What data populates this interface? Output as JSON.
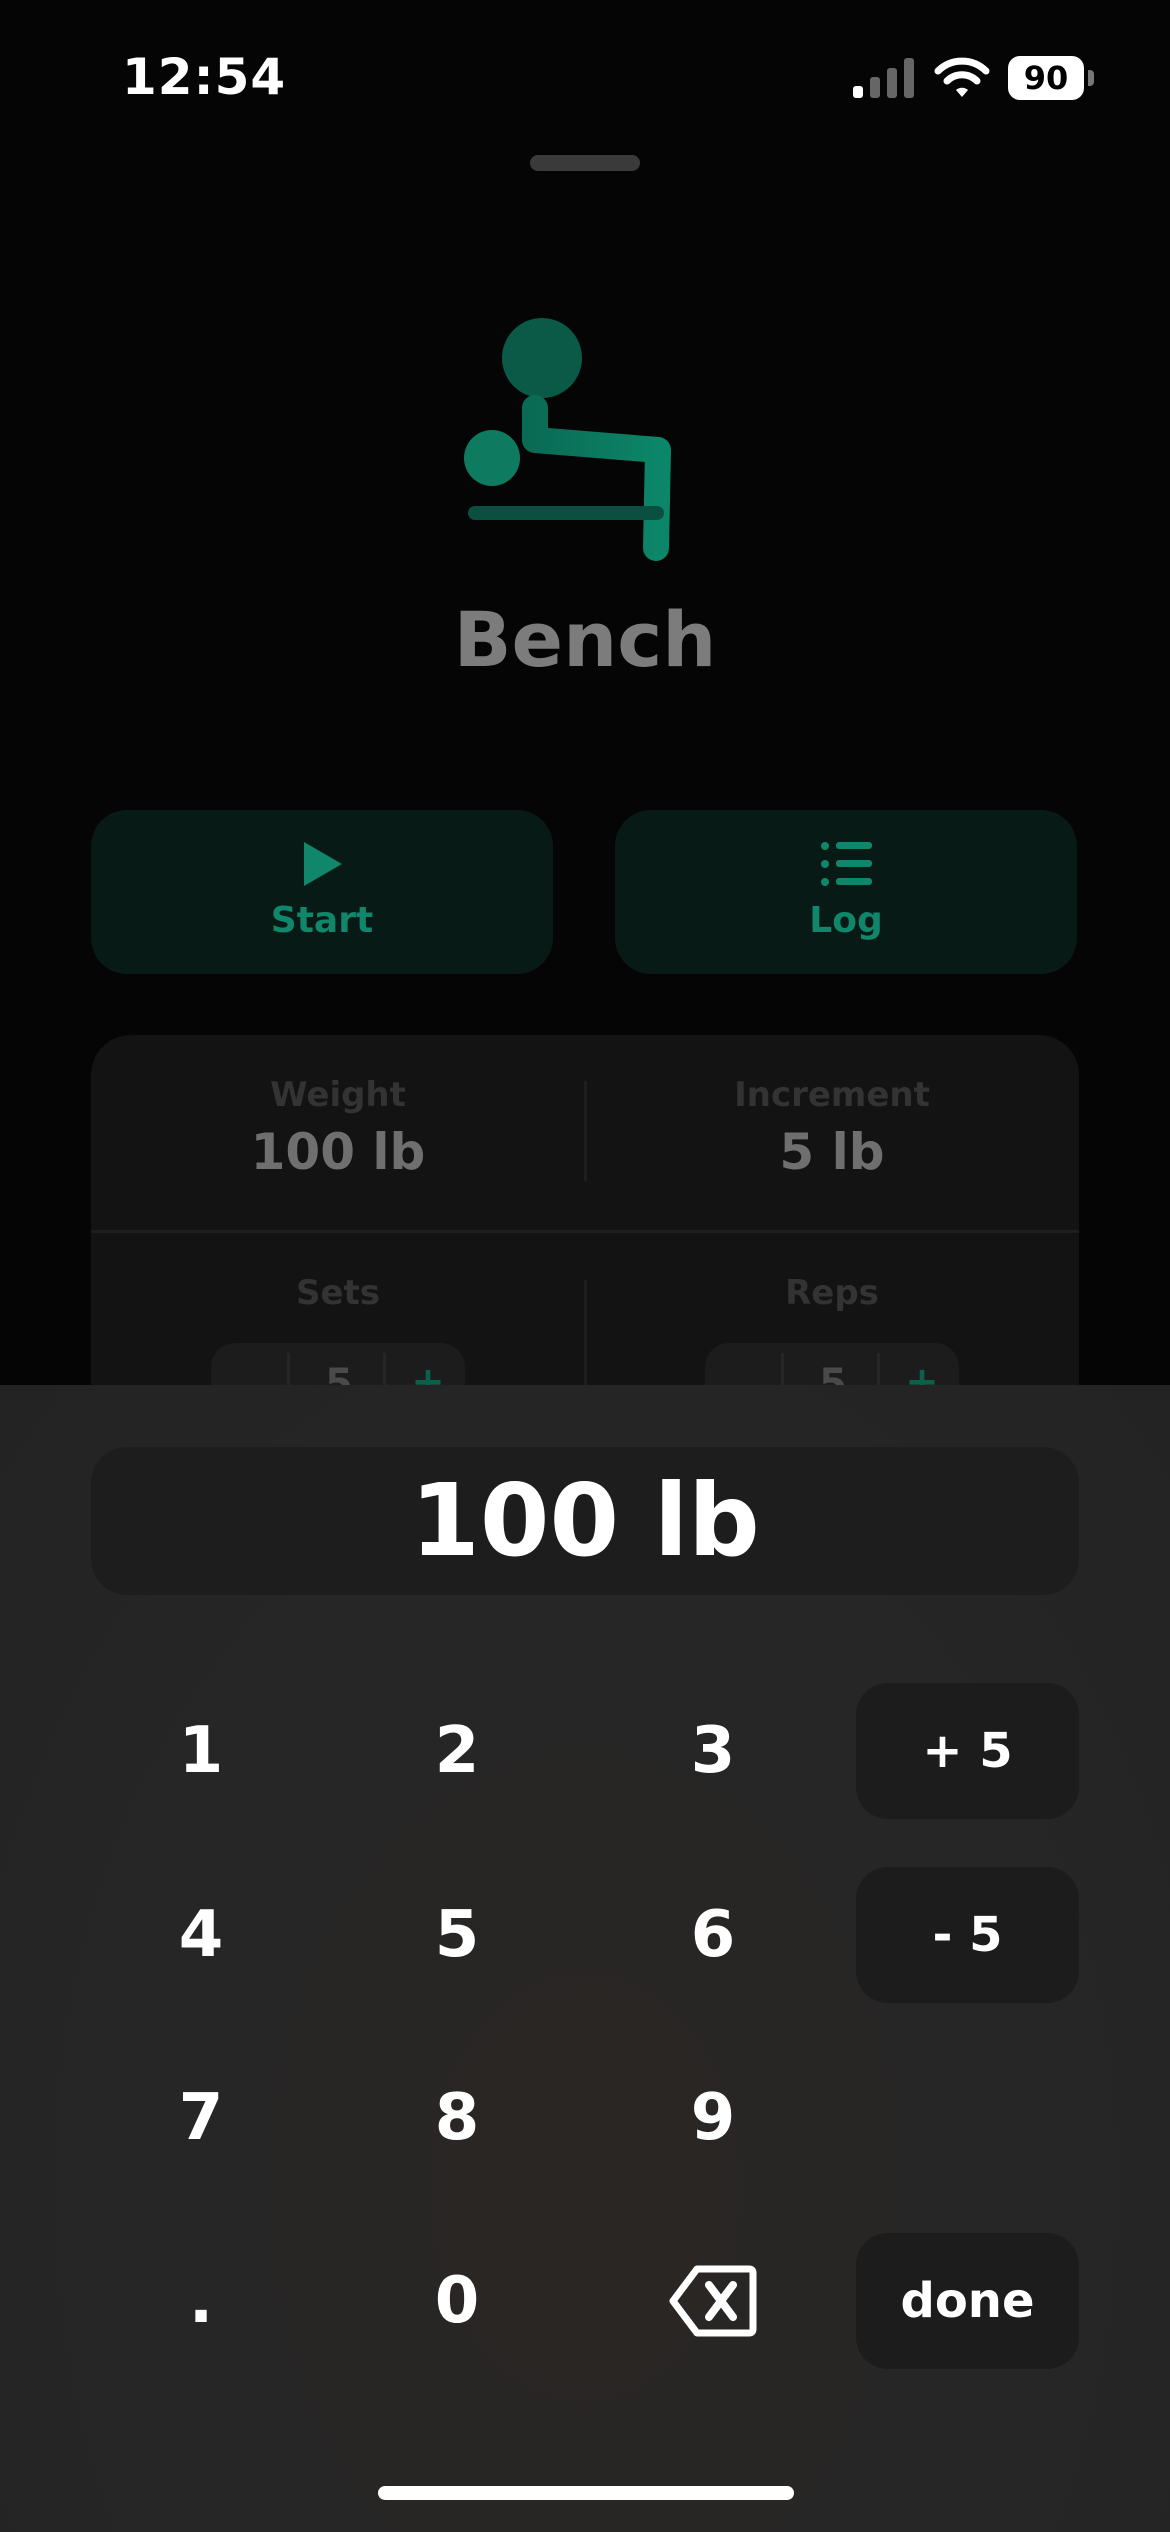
{
  "status_bar": {
    "time": "12:54",
    "battery_level": "90",
    "icons": [
      "cellular-signal-icon",
      "wifi-icon",
      "battery-icon"
    ]
  },
  "exercise": {
    "name": "Bench",
    "icon": "bench-press-icon"
  },
  "actions": {
    "start_label": "Start",
    "log_label": "Log"
  },
  "settings": {
    "weight_label": "Weight",
    "weight_value": "100 lb",
    "increment_label": "Increment",
    "increment_value": "5 lb",
    "sets_label": "Sets",
    "sets_value": "5",
    "reps_label": "Reps",
    "reps_value": "5",
    "stepper_plus": "+"
  },
  "keypad": {
    "display_value": "100 lb",
    "keys": {
      "k1": "1",
      "k2": "2",
      "k3": "3",
      "k4": "4",
      "k5": "5",
      "k6": "6",
      "k7": "7",
      "k8": "8",
      "k9": "9",
      "dot": ".",
      "k0": "0"
    },
    "plus_increment": "+ 5",
    "minus_increment": "- 5",
    "done_label": "done"
  },
  "colors": {
    "accent": "#10866a",
    "accent_bg": "#081a15",
    "title_gray": "#7c7c7c",
    "sheet_bg": "#262626",
    "key_bg": "#1c1c1c"
  }
}
